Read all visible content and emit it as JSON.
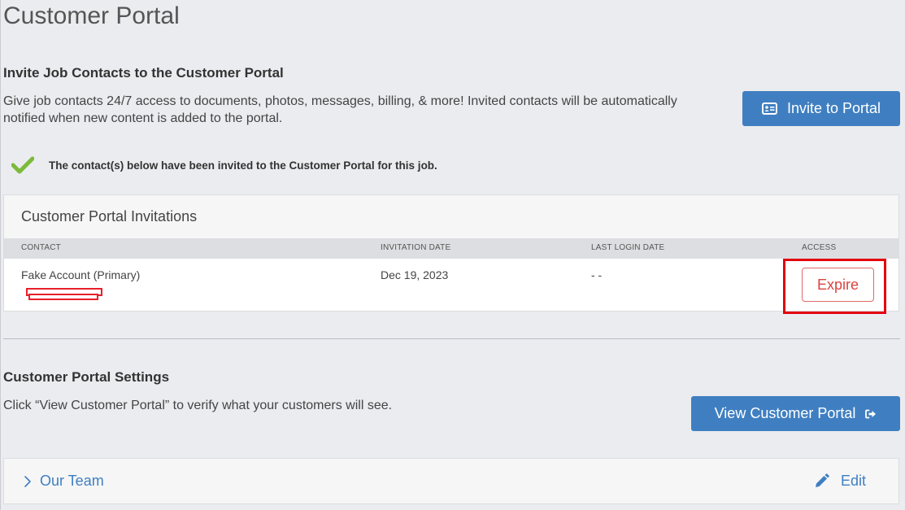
{
  "page": {
    "title": "Customer Portal"
  },
  "invite_section": {
    "heading": "Invite Job Contacts to the Customer Portal",
    "description": "Give job contacts 24/7 access to documents, photos, messages, billing, & more! Invited contacts will be automatically notified when new content is added to the portal.",
    "button_label": "Invite to Portal",
    "button_icon": "contact-card-icon"
  },
  "notice": {
    "icon": "check-icon",
    "text": "The contact(s) below have been invited to the Customer Portal for this job."
  },
  "invitations": {
    "title": "Customer Portal Invitations",
    "columns": {
      "contact": "CONTACT",
      "invitation_date": "INVITATION DATE",
      "last_login_date": "LAST LOGIN DATE",
      "access": "ACCESS"
    },
    "rows": [
      {
        "contact": "Fake Account (Primary)",
        "invitation_date": "Dec 19, 2023",
        "last_login_date": "- -",
        "access_button": "Expire"
      }
    ]
  },
  "settings_section": {
    "heading": "Customer Portal Settings",
    "description": "Click “View Customer Portal” to verify what your customers will see.",
    "button_label": "View Customer Portal",
    "button_icon": "sign-out-icon"
  },
  "team_panel": {
    "label": "Our Team",
    "toggle_icon": "chevron-right-icon",
    "edit_label": "Edit",
    "edit_icon": "pencil-icon"
  },
  "colors": {
    "background": "#ebecf0",
    "primary": "#3f7fc1",
    "success": "#7cbb3a",
    "danger": "#d9443f",
    "highlight": "#e3000f"
  }
}
